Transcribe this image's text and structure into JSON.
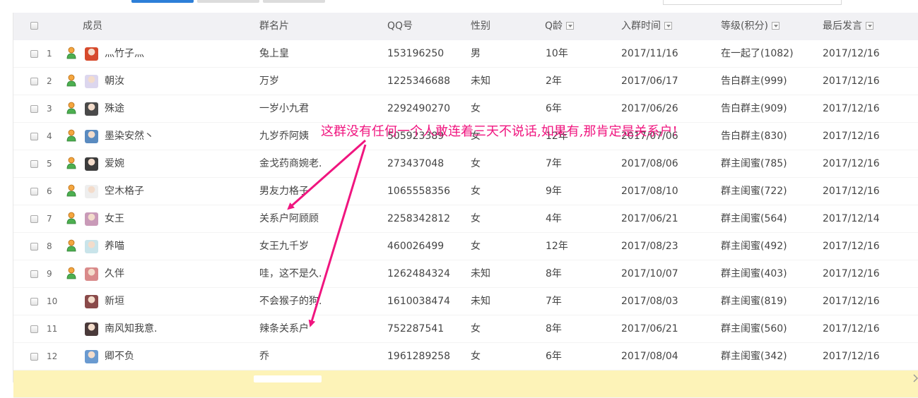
{
  "columns": {
    "member": "成员",
    "card": "群名片",
    "qq": "QQ号",
    "gender": "性别",
    "qage": "Q龄",
    "join": "入群时间",
    "level": "等级(积分)",
    "last": "最后发言"
  },
  "rows": [
    {
      "n": "1",
      "name": "灬竹子灬",
      "card": "兔上皇",
      "qq": "153196250",
      "gender": "男",
      "qage": "10年",
      "join": "2017/11/16",
      "level": "在一起了(1082)",
      "last": "2017/12/16",
      "admin": true,
      "avatar_color": "#d64a2c"
    },
    {
      "n": "2",
      "name": "朝汝",
      "card": "万岁",
      "qq": "1225346688",
      "gender": "未知",
      "qage": "2年",
      "join": "2017/06/17",
      "level": "告白群主(999)",
      "last": "2017/12/16",
      "admin": true,
      "avatar_color": "#dcd6ee"
    },
    {
      "n": "3",
      "name": "殊途",
      "card": "一岁小九君",
      "qq": "2292490270",
      "gender": "女",
      "qage": "6年",
      "join": "2017/06/26",
      "level": "告白群主(909)",
      "last": "2017/12/16",
      "admin": true,
      "avatar_color": "#4a4a4a"
    },
    {
      "n": "4",
      "name": "墨染安然丶",
      "card": "九岁乔阿姨",
      "qq": "505923389",
      "gender": "女",
      "qage": "12年",
      "join": "2017/07/06",
      "level": "告白群主(830)",
      "last": "2017/12/16",
      "admin": true,
      "avatar_color": "#5a8bc0"
    },
    {
      "n": "5",
      "name": "爱婉",
      "card": "金戈药商婉老.",
      "qq": "273437048",
      "gender": "女",
      "qage": "7年",
      "join": "2017/08/06",
      "level": "群主闺蜜(785)",
      "last": "2017/12/16",
      "admin": true,
      "avatar_color": "#3c3c3c"
    },
    {
      "n": "6",
      "name": "空木格子",
      "card": "男友力格子",
      "qq": "1065558356",
      "gender": "女",
      "qage": "9年",
      "join": "2017/08/10",
      "level": "群主闺蜜(722)",
      "last": "2017/12/16",
      "admin": true,
      "avatar_color": "#eeeeee"
    },
    {
      "n": "7",
      "name": "女王",
      "card": "关系户阿顾顾",
      "qq": "2258342812",
      "gender": "女",
      "qage": "4年",
      "join": "2017/06/21",
      "level": "群主闺蜜(564)",
      "last": "2017/12/14",
      "admin": true,
      "avatar_color": "#c99ab8"
    },
    {
      "n": "8",
      "name": "养喵",
      "card": "女王九千岁",
      "qq": "460026499",
      "gender": "女",
      "qage": "12年",
      "join": "2017/08/23",
      "level": "群主闺蜜(492)",
      "last": "2017/12/16",
      "admin": true,
      "avatar_color": "#c9e4ea"
    },
    {
      "n": "9",
      "name": "久伴",
      "card": "哇，这不是久.",
      "qq": "1262484324",
      "gender": "未知",
      "qage": "8年",
      "join": "2017/10/07",
      "level": "群主闺蜜(403)",
      "last": "2017/12/16",
      "admin": true,
      "avatar_color": "#d98a8a"
    },
    {
      "n": "10",
      "name": "新垣",
      "card": "不会猴子的狗.",
      "qq": "1610038474",
      "gender": "未知",
      "qage": "7年",
      "join": "2017/08/03",
      "level": "群主闺蜜(819)",
      "last": "2017/12/16",
      "admin": false,
      "avatar_color": "#8a4a4a"
    },
    {
      "n": "11",
      "name": "南风知我意.",
      "card": "辣条关系户",
      "qq": "752287541",
      "gender": "女",
      "qage": "8年",
      "join": "2017/06/21",
      "level": "群主闺蜜(560)",
      "last": "2017/12/16",
      "admin": false,
      "avatar_color": "#4a3a3a"
    },
    {
      "n": "12",
      "name": "卿不负",
      "card": "乔",
      "qq": "1961289258",
      "gender": "女",
      "qage": "6年",
      "join": "2017/08/04",
      "level": "群主闺蜜(342)",
      "last": "2017/12/16",
      "admin": false,
      "avatar_color": "#6a9ad0"
    }
  ],
  "annotation": "这群没有任何一个人敢连着三天不说话,如果有,那肯定是关系户!",
  "colors": {
    "accent": "#2d7fd8",
    "annotation": "#f0157f",
    "highlight_row": "#fdf3b8",
    "header_bg": "#f1f1f4"
  },
  "icons": {
    "admin": "person-icon",
    "sort": "dropdown-sort-icon"
  }
}
